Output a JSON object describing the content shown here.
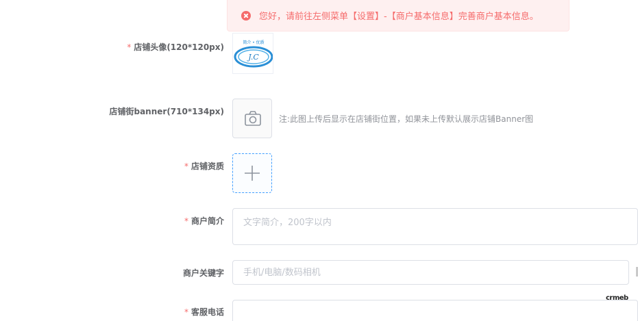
{
  "notice": {
    "text": "您好，请前往左侧菜单【设置】-【商户基本信息】完善商户基本信息。",
    "color": "#f56c6c",
    "icon": "error-circle-icon"
  },
  "form": {
    "avatar": {
      "required": "*",
      "label": "店铺头像(120*120px)",
      "logo_top_text": "简介 • 优质",
      "logo_center_text": "J.C"
    },
    "banner": {
      "label": "店铺街banner(710*134px)",
      "icon": "camera-icon",
      "hint": "注:此图上传后显示在店铺街位置，如果未上传默认展示店铺Banner图"
    },
    "qualification": {
      "required": "*",
      "label": "店铺资质",
      "icon": "plus-icon"
    },
    "intro": {
      "required": "*",
      "label": "商户简介",
      "placeholder": "文字简介，200字以内"
    },
    "keywords": {
      "label": "商户关键字",
      "placeholder": "手机/电脑/数码相机"
    },
    "phone": {
      "required": "*",
      "label": "客服电话"
    }
  },
  "watermark": "crmeb",
  "accent_color": "#409eff"
}
